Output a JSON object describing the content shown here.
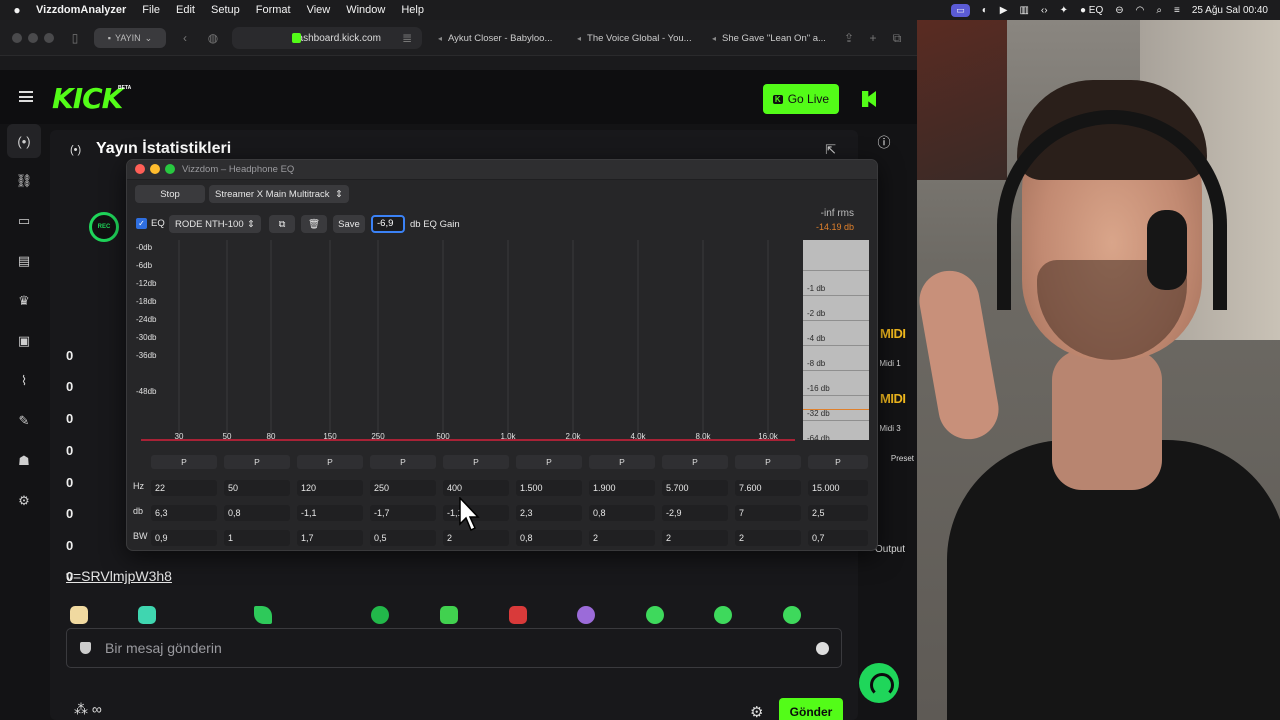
{
  "menubar": {
    "app": "VizzdomAnalyzer",
    "items": [
      "File",
      "Edit",
      "Setup",
      "Format",
      "View",
      "Window",
      "Help"
    ],
    "eq_label": "EQ",
    "datetime": "25 Ağu Sal  00:40"
  },
  "browser": {
    "tab_group": "YAYIN",
    "url": "dashboard.kick.com",
    "tabs": [
      "Aykut Closer - Babyloo...",
      "The Voice Global - You...",
      "She Gave \"Lean On\" a..."
    ]
  },
  "kick": {
    "logo": "KICK",
    "beta": "BETA",
    "go_live": "Go Live",
    "dash_title": "Yayın İstatistikleri",
    "stat_zeros": [
      "0",
      "0",
      "0",
      "0",
      "0",
      "0",
      "0",
      "0"
    ],
    "chat_link": "v=SRVlmjpW3h8",
    "chat_placeholder": "Bir mesaj gönderin",
    "send_label": "Gönder",
    "midi1": "Midi 1",
    "midi3": "Midi 3",
    "preset_label": "Preset",
    "output_label": "Output",
    "rec_label": "REC",
    "midi_logo": "MIDI"
  },
  "eq": {
    "window_title": "Vizzdom – Headphone EQ",
    "stop_label": "Stop",
    "output_select": "Streamer X Main Multitrack",
    "eq_label": "EQ",
    "device_select": "RODE NTH-100",
    "save_label": "Save",
    "gain_value": "-6,9",
    "gain_label": "db EQ Gain",
    "rms_label": "-inf rms",
    "rms_db": "-14.19 db",
    "db_labels": [
      "-0db",
      "-6db",
      "-12db",
      "-18db",
      "-24db",
      "-30db",
      "-36db",
      "-48db"
    ],
    "hz_labels": [
      "30",
      "50",
      "80",
      "150",
      "250",
      "500",
      "1.0k",
      "2.0k",
      "4.0k",
      "8.0k",
      "16.0k"
    ],
    "meter_labels": [
      "-1 db",
      "-2 db",
      "-4 db",
      "-8 db",
      "-16 db",
      "-32 db",
      "-64 db"
    ],
    "row_labels": {
      "hz": "Hz",
      "db": "db",
      "bw": "BW"
    },
    "bands": [
      {
        "type": "P",
        "hz": "22",
        "db": "6,3",
        "bw": "0,9"
      },
      {
        "type": "P",
        "hz": "50",
        "db": "0,8",
        "bw": "1"
      },
      {
        "type": "P",
        "hz": "120",
        "db": "-1,1",
        "bw": "1,7"
      },
      {
        "type": "P",
        "hz": "250",
        "db": "-1,7",
        "bw": "0,5"
      },
      {
        "type": "P",
        "hz": "400",
        "db": "-1,1",
        "bw": "2"
      },
      {
        "type": "P",
        "hz": "1.500",
        "db": "2,3",
        "bw": "0,8"
      },
      {
        "type": "P",
        "hz": "1.900",
        "db": "0,8",
        "bw": "2"
      },
      {
        "type": "P",
        "hz": "5.700",
        "db": "-2,9",
        "bw": "2"
      },
      {
        "type": "P",
        "hz": "7.600",
        "db": "7",
        "bw": "2"
      },
      {
        "type": "P",
        "hz": "15.000",
        "db": "2,5",
        "bw": "0,7"
      }
    ]
  },
  "colors": {
    "kick_green": "#53fc18",
    "accent_blue": "#3b82f6",
    "meter_orange": "#e0802b"
  }
}
